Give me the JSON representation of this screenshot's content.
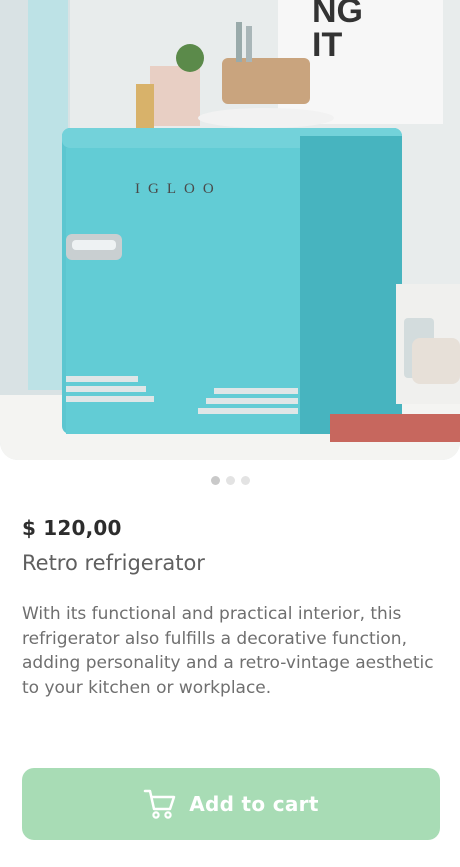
{
  "product": {
    "brand_badge": "IGLOO",
    "poster_text": "NG IT",
    "price": "$ 120,00",
    "name": "Retro refrigerator",
    "description": "With its functional and practical interior, this refrigerator also fulfills a decorative function, adding personality and a retro-vintage aesthetic to your kitchen or workplace."
  },
  "carousel": {
    "total": 3,
    "active": 1
  },
  "actions": {
    "add_to_cart_label": "Add to cart",
    "icon": "cart-icon"
  },
  "colors": {
    "accent": "#a8dcb5",
    "fridge": "#5cc6d0"
  }
}
